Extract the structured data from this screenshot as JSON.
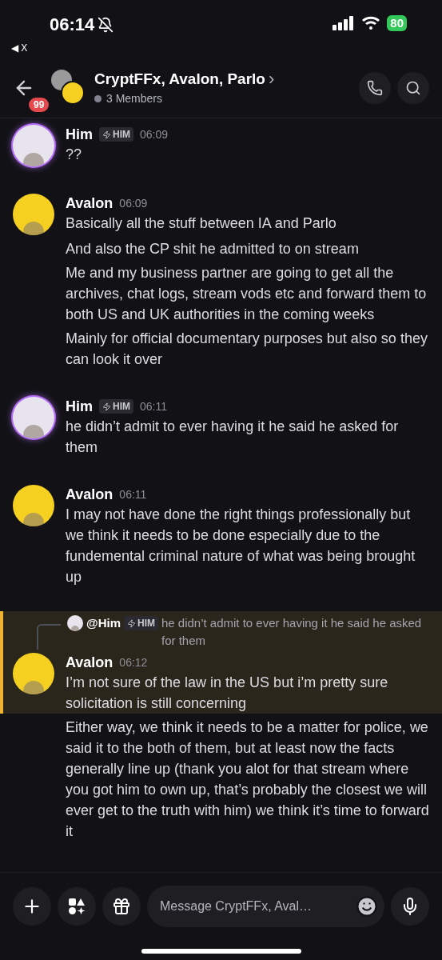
{
  "status_bar": {
    "time": "06:14",
    "back_label": "◀ X",
    "battery": "80"
  },
  "header": {
    "unread": "99",
    "title": "CryptFFx, Avalon, Parlo",
    "chevron": "›",
    "members": "3 Members"
  },
  "groups": [
    {
      "author": "Him",
      "tag": "HIM",
      "time": "06:09",
      "color": "#e8e4ee",
      "ring": true,
      "messages": [
        {
          "text": "??",
          "highlighted": false
        }
      ]
    },
    {
      "author": "Avalon",
      "time": "06:09",
      "color": "#f5d020",
      "ring": false,
      "messages": [
        {
          "text": "Basically all the stuff between IA and Parlo",
          "highlighted": false
        },
        {
          "text": "And also the CP shit he admitted to on stream",
          "highlighted": false
        },
        {
          "text": "Me and my business partner are going to get all the archives, chat logs, stream vods etc and forward them to both US and UK authorities in the coming weeks",
          "highlighted": false
        },
        {
          "text": "Mainly for official documentary purposes but also so they can look it over",
          "highlighted": false
        }
      ]
    },
    {
      "author": "Him",
      "tag": "HIM",
      "time": "06:11",
      "color": "#e8e4ee",
      "ring": true,
      "messages": [
        {
          "text": "he didn’t admit to ever having it he said he asked for them",
          "highlighted": false
        }
      ]
    },
    {
      "author": "Avalon",
      "time": "06:11",
      "color": "#f5d020",
      "ring": false,
      "messages": [
        {
          "text": "I may not have done the right things professionally but we think it needs to be done especially due to the fundemental criminal nature of what was being brought up",
          "highlighted": false
        }
      ]
    },
    {
      "author": "Avalon",
      "time": "06:12",
      "color": "#f5d020",
      "ring": false,
      "reply": {
        "author": "@Him",
        "tag": "HIM",
        "text": "he didn’t admit to ever having it he said he asked for them",
        "color": "#e8e4ee"
      },
      "messages": [
        {
          "text": "I’m not sure of the law in the US but i’m pretty sure solicitation is still concerning",
          "highlighted": true
        },
        {
          "text": "Either way, we think it needs to be a matter for police, we said it to the both of them, but at least now the facts generally line up (thank you alot for that stream where you got him to own up, that’s probably the closest we will ever get to the truth with him) we think it’s time to forward it",
          "highlighted": false
        }
      ]
    }
  ],
  "composer": {
    "placeholder": "Message CryptFFx, Aval…"
  }
}
